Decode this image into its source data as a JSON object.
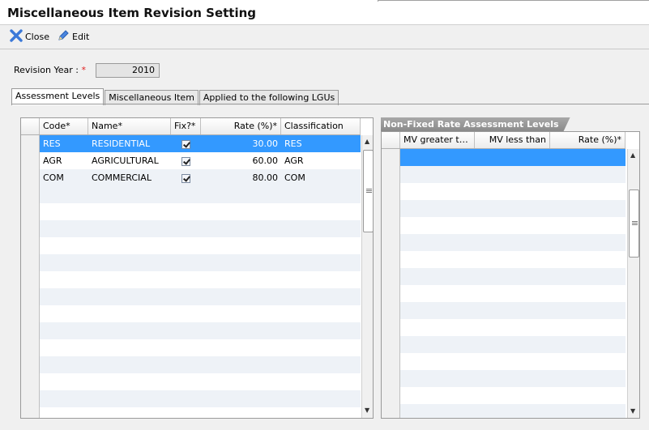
{
  "window": {
    "title": "Miscellaneous Item Revision Setting"
  },
  "toolbar": {
    "close_label": "Close",
    "edit_label": "Edit"
  },
  "form": {
    "revision_year_label": "Revision Year :",
    "required_mark": "*",
    "revision_year_value": "2010"
  },
  "tabs": [
    {
      "label": "Assessment Levels"
    },
    {
      "label": "Miscellaneous Item"
    },
    {
      "label": "Applied to the following LGUs"
    }
  ],
  "assessment_grid": {
    "columns": [
      "Code*",
      "Name*",
      "Fix?*",
      "Rate (%)*",
      "Classification"
    ],
    "rows": [
      {
        "code": "RES",
        "name": "RESIDENTIAL",
        "fix": true,
        "rate": "30.00",
        "classification": "RES"
      },
      {
        "code": "AGR",
        "name": "AGRICULTURAL",
        "fix": true,
        "rate": "60.00",
        "classification": "AGR"
      },
      {
        "code": "COM",
        "name": "COMMERCIAL",
        "fix": true,
        "rate": "80.00",
        "classification": "COM"
      }
    ]
  },
  "nonfixed_panel": {
    "title": "Non-Fixed Rate Assessment Levels",
    "columns": [
      "MV greater th...",
      "MV less than",
      "Rate (%)*"
    ]
  },
  "colors": {
    "selection": "#3399ff",
    "alt_row": "#eef2f7",
    "required": "#e02020",
    "accent_icon": "#2f6fd6"
  }
}
